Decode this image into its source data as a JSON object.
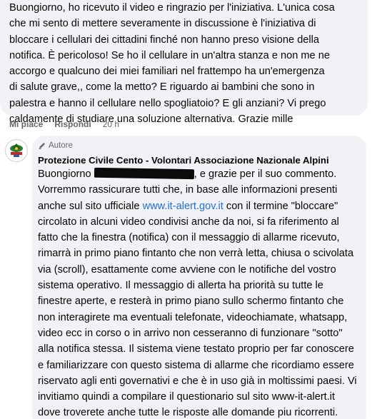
{
  "comment": {
    "text": "Buongiorno, ho ricevuto il video e ringrazio per l'iniziativa. L'unica cosa\nche mi sento di mettere severamente in discussione è l'iniziativa di\nbloccare i cellulari dei cittadini finché non hanno preso visione della\nnotifica. È pericoloso! Se ho il cellulare in un'altra stanza e non me ne\naccorgo e qualcuno dei miei familiari nel frattempo ha un'emergenza\ndi salute grave,, come la metto? E riguardo ai bambini che sono in\npalestra e hanno il cellulare nello spogliatoio? E gli anziani? Vi prego\ncaldamente di studiare una soluzione alternativa. Grazie mille",
    "like_label": "Mi piace",
    "reply_label": "Rispondi",
    "time": "20 h"
  },
  "reply": {
    "badge_label": "Autore",
    "author": "Protezione Civile Cento - Volontari Associazione Nazionale Alpini",
    "greeting": "Buongiorno",
    "after_redaction": ", e grazie per il suo commento.",
    "body_before_link": "Vorremmo rassicurare tutti che, in base alle informazioni presenti anche sul sito ufficiale ",
    "link_text": "www.it-alert.gov.it",
    "body_after_link": " con il termine \"bloccare\" circolato in alcuni video condivisi anche da noi, si fa riferimento al fatto che la finestra (notifica) con il messaggio di allarme ricevuto, rimarrà in primo piano fintanto che non verrà letta, chiusa o scivolata via (scroll), esattamente come avviene con le notifiche del vostro sistema operativo. Il messaggio di allerta ha priorità su tutte le finestre aperte, e resterà in primo piano sullo schermo fintanto che non interagirete ma eventuali telefonate, videochiamate, whatsapp, video ecc in corso o in arrivo non cesseranno di funzionare \"sotto\" alla notifica stessa. Il sistema viene testato proprio per far conoscere e familiarizzare con questo sistema di allarme che ricordiamo essere riservato agli enti governativi e che è in uso già in moltissimi paesi. Vi invitiamo quindi a compilare il questionario sul sito www-it-alert.it dove troverete anche tutte le risposte alle domande piu ricorrenti."
  },
  "colors": {
    "bubble_bg": "#f0f2f5",
    "link": "#216fdb",
    "meta_text": "#65676b"
  },
  "icons": {
    "badge": "pencil-icon",
    "avatar": "protezione-civile-alpini-logo"
  }
}
